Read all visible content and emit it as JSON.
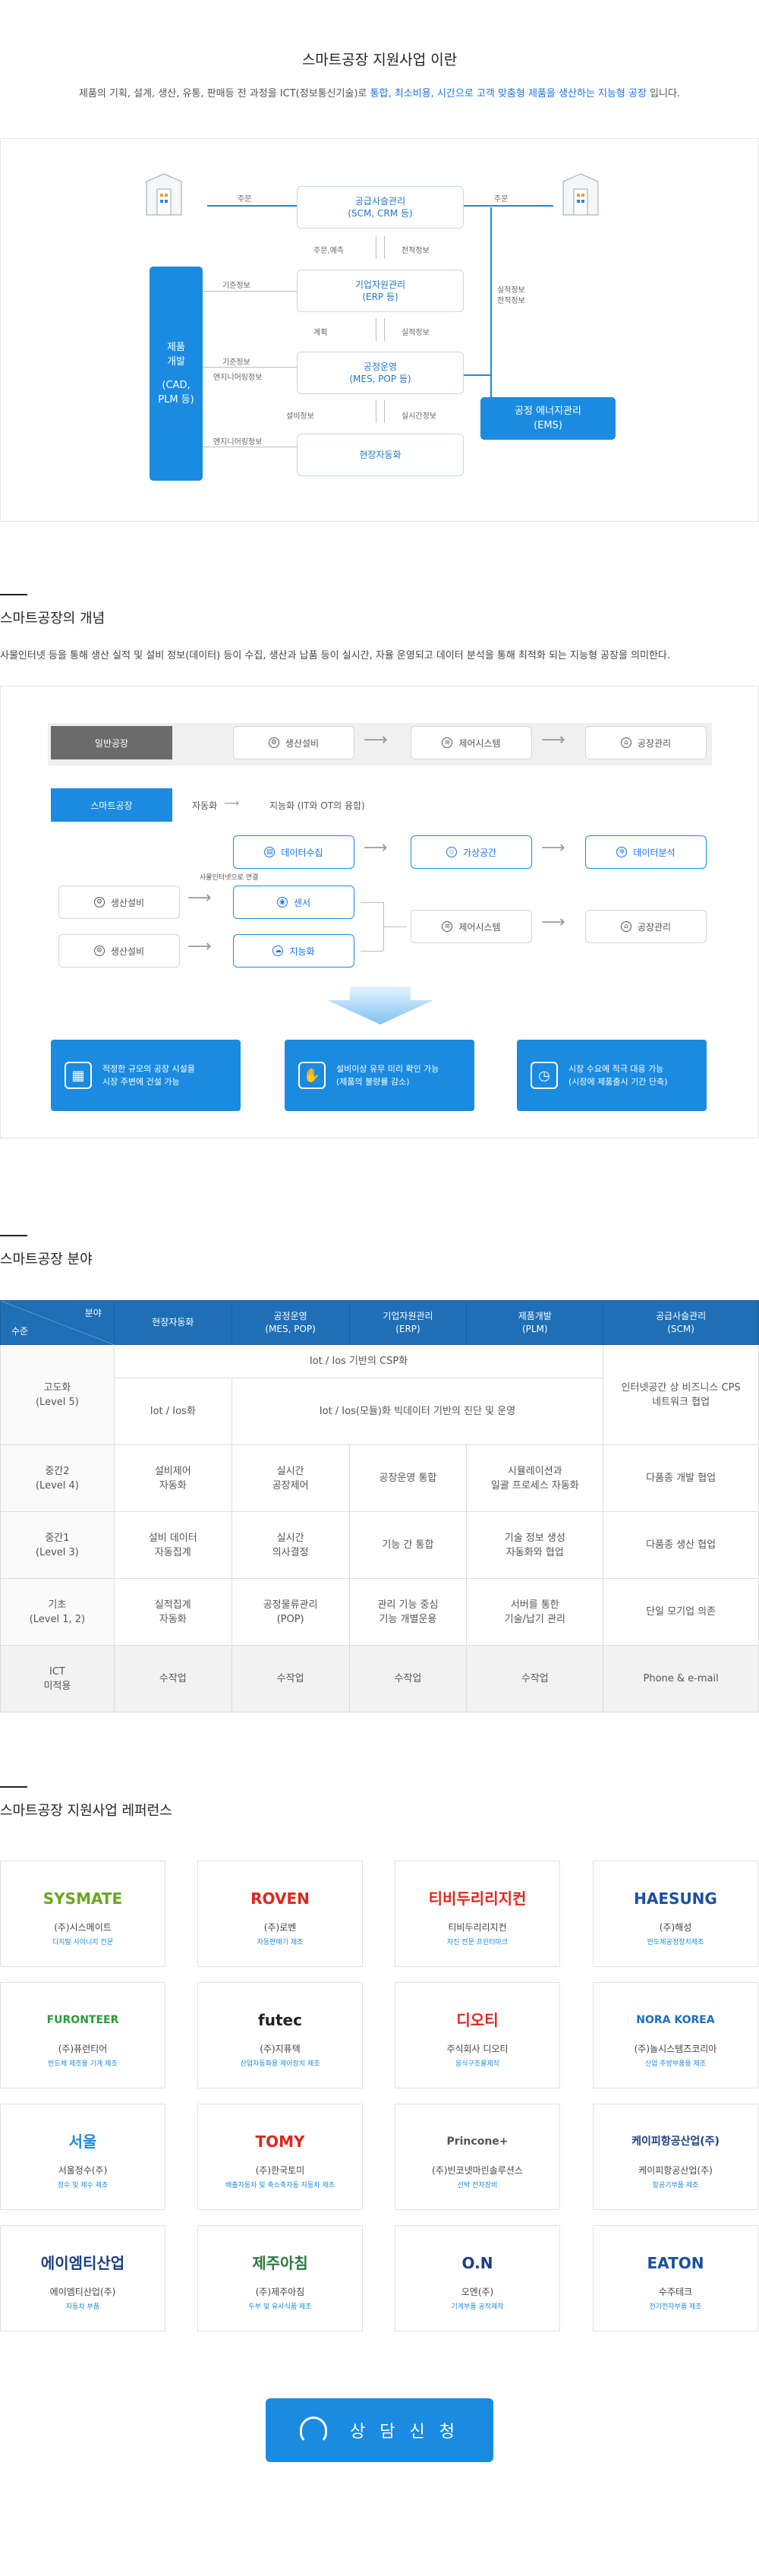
{
  "section1": {
    "title": "스마트공장 지원사업 이란",
    "intro_pre": "제품의 기획, 설계, 생산, 유통, 판매등 전 과정을 ICT(정보통신기술)로 ",
    "intro_hl": "통합, 최소비용, 시간으로 고객 맞춤형 제품을 생산하는 지능형 공장",
    "intro_post": " 입니다.",
    "scm": [
      "공급사슬관리",
      "(SCM, CRM 등)"
    ],
    "erp": [
      "기업자원관리",
      "(ERP 등)"
    ],
    "mes": [
      "공정운영",
      "(MES, POP 등)"
    ],
    "auto": "현장자동화",
    "plm": [
      "제품",
      "개발",
      "(CAD,",
      "PLM 등)"
    ],
    "ems": [
      "공정 에너지관리",
      "(EMS)"
    ],
    "labels": {
      "order_left": "주문",
      "order_right": "주문",
      "order_plan": "주문,예측",
      "perf_info": "전적정보",
      "plan": "계획",
      "perf_info2": "실적정보",
      "ctrl_info": "설비정보",
      "realtime_info": "실시간정보",
      "std_info1": "기준정보",
      "std_info2": "기준정보",
      "eng_info1": "엔지니어링정보",
      "eng_info2": "엔지니어링정보",
      "perf_side": "실적정보",
      "perf_side2": "전적정보"
    }
  },
  "section2": {
    "heading": "스마트공장의 개념",
    "desc": "사물인터넷 등을 통해 생산 실적 및 설비 정보(데이터) 등이 수집, 생산과 납품 등이 실시간, 자율 운영되고 데이터 분석을 통해 최적화 되는 지능형 공장을 의미한다.",
    "general": "일반공장",
    "g1": "생산설비",
    "g2": "제어시스템",
    "g3": "공장관리",
    "smart": "스마트공장",
    "auto_label": "자동화",
    "auto_desc": "지능화 (IT와 OT의 융합)",
    "data_collect": "데이터수집",
    "virtual": "가상공간",
    "data_analysis": "데이터분석",
    "iot_note": "사물인터넷으로 연결",
    "equip1": "생산설비",
    "equip2": "생산설비",
    "sensor": "센서",
    "intel": "지능화",
    "ctrl": "제어시스템",
    "mgmt": "공장관리",
    "features": [
      [
        "적정한 규모의 공장 시설을",
        "시장 주변에 건설 가능"
      ],
      [
        "설비이상 유무 미리 확인 가능",
        "(제품의 불량률 감소)"
      ],
      [
        "시장 수요에 적극 대응 가능",
        "(시장에 제품출시 기간 단축)"
      ]
    ]
  },
  "section3": {
    "heading": "스마트공장 분야",
    "corner_top": "분야",
    "corner_bottom": "수준",
    "cols": [
      "현장자동화",
      "공정운영\n(MES, POP)",
      "기업자원관리\n(ERP)",
      "제품개발\n(PLM)",
      "공급사슬관리\n(SCM)"
    ],
    "rows": [
      {
        "level": "고도화\n(Level 5)",
        "span_top": "Iot / Ios 기반의 CSP화",
        "c1": "Iot / Ios화",
        "span_bottom": "Iot / Ios(모듈)화 빅데이터 기반의 진단 및 운영",
        "scm": "인터넷공간 상 비즈니스 CPS\n네트워크 협업"
      },
      {
        "level": "중간2\n(Level 4)",
        "cells": [
          "설비제어\n자동화",
          "실시간\n공장제어",
          "공장운영 통합",
          "시뮬레이션과\n일괄 프로세스 자동화",
          "다품종 개발 협업"
        ]
      },
      {
        "level": "중간1\n(Level 3)",
        "cells": [
          "설비 데이터\n자동집계",
          "실시간\n의사결정",
          "기능 간 통합",
          "기술 정보 생성\n자동화와 협업",
          "다품종 생산 협업"
        ]
      },
      {
        "level": "기초\n(Level 1, 2)",
        "cells": [
          "실적집계\n자동화",
          "공정물류관리\n(POP)",
          "관리 기능 중심\n기능 개별운용",
          "서버를 통한\n기술/납기 관리",
          "단일 모기업 의존"
        ]
      },
      {
        "level": "ICT\n미적용",
        "cells": [
          "수작업",
          "수작업",
          "수작업",
          "수작업",
          "Phone & e-mail"
        ]
      }
    ]
  },
  "section4": {
    "heading": "스마트공장 지원사업 레퍼런스",
    "companies": [
      {
        "logo": "SYSMATE",
        "name": "(주)시스메이트",
        "sub": "디지털 사이니지 전문",
        "color": "#6aa620"
      },
      {
        "logo": "ROVEN",
        "name": "(주)로벤",
        "sub": "자동판매기 제조",
        "color": "#e0261c"
      },
      {
        "logo": "티비두리리지컨",
        "name": "티비두리리지컨",
        "sub": "자진 전문 프린터마크",
        "color": "#e0261c"
      },
      {
        "logo": "HAESUNG",
        "name": "(주)해성",
        "sub": "반도체공정장치제조",
        "color": "#1c4fa0"
      },
      {
        "logo": "FURONTEER",
        "name": "(주)퓨런티어",
        "sub": "반도체 제조용 기계 제조",
        "color": "#2a9a3c"
      },
      {
        "logo": "futec",
        "name": "(주)지퓨텍",
        "sub": "산업자동화용 제어장치 제조",
        "color": "#222222"
      },
      {
        "logo": "디오티",
        "name": "주식회사 디오티",
        "sub": "음식구조물제작",
        "color": "#e0261c"
      },
      {
        "logo": "NORA KOREA",
        "name": "(주)놀시스템즈코리아",
        "sub": "산업 주방부품용 제조",
        "color": "#1c6fc0"
      },
      {
        "logo": "서울",
        "name": "서울정수(주)",
        "sub": "정수 및 제수 제조",
        "color": "#1a8be0"
      },
      {
        "logo": "TOMY",
        "name": "(주)한국토미",
        "sub": "배출자동차 및 축소축자동 자동차 제조",
        "color": "#e0261c"
      },
      {
        "logo": "Princone+",
        "name": "(주)빈코넷마린솔루션스",
        "sub": "선박 전자장비",
        "color": "#555555"
      },
      {
        "logo": "케이피항공산업(주)",
        "name": "케이피항공산업(주)",
        "sub": "항공기부품 제조",
        "color": "#1c3f80"
      },
      {
        "logo": "에이엠티산업",
        "name": "에이엠티산업(주)",
        "sub": "자동차 부품",
        "color": "#1c3f80"
      },
      {
        "logo": "제주아침",
        "name": "(주)제주아침",
        "sub": "두부 및 유사식품 제조",
        "color": "#2a7a3c"
      },
      {
        "logo": "O.N",
        "name": "오엔(주)",
        "sub": "기계부품 공작제작",
        "color": "#1c3f80"
      },
      {
        "logo": "EATON",
        "name": "수주테크",
        "sub": "전기전자부품 제조",
        "color": "#1c4fa0"
      }
    ]
  },
  "cta": {
    "label": "상 담 신 청"
  }
}
